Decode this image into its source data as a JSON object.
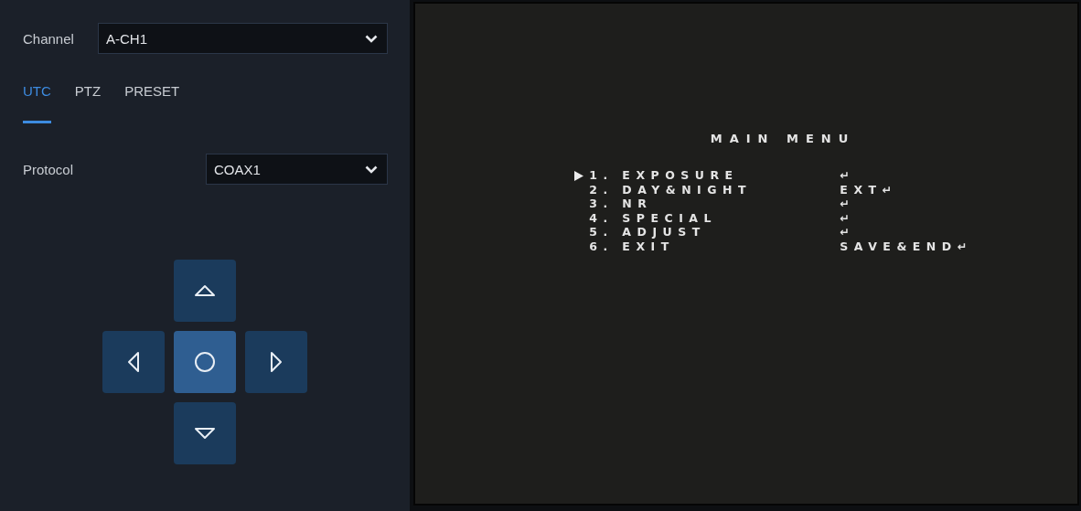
{
  "channel": {
    "label": "Channel",
    "value": "A-CH1"
  },
  "tabs": [
    {
      "label": "UTC",
      "selected": true
    },
    {
      "label": "PTZ",
      "selected": false
    },
    {
      "label": "PRESET",
      "selected": false
    }
  ],
  "protocol": {
    "label": "Protocol",
    "value": "COAX1"
  },
  "osd": {
    "title": "MAIN MENU",
    "items": [
      {
        "number": "1.",
        "label": "EXPOSURE",
        "value": "↵",
        "selected": true
      },
      {
        "number": "2.",
        "label": "DAY&NIGHT",
        "value": "EXT↵",
        "selected": false
      },
      {
        "number": "3.",
        "label": "NR",
        "value": "↵",
        "selected": false
      },
      {
        "number": "4.",
        "label": "SPECIAL",
        "value": "↵",
        "selected": false
      },
      {
        "number": "5.",
        "label": "ADJUST",
        "value": "↵",
        "selected": false
      },
      {
        "number": "6.",
        "label": "EXIT",
        "value": "SAVE&END↵",
        "selected": false
      }
    ]
  }
}
